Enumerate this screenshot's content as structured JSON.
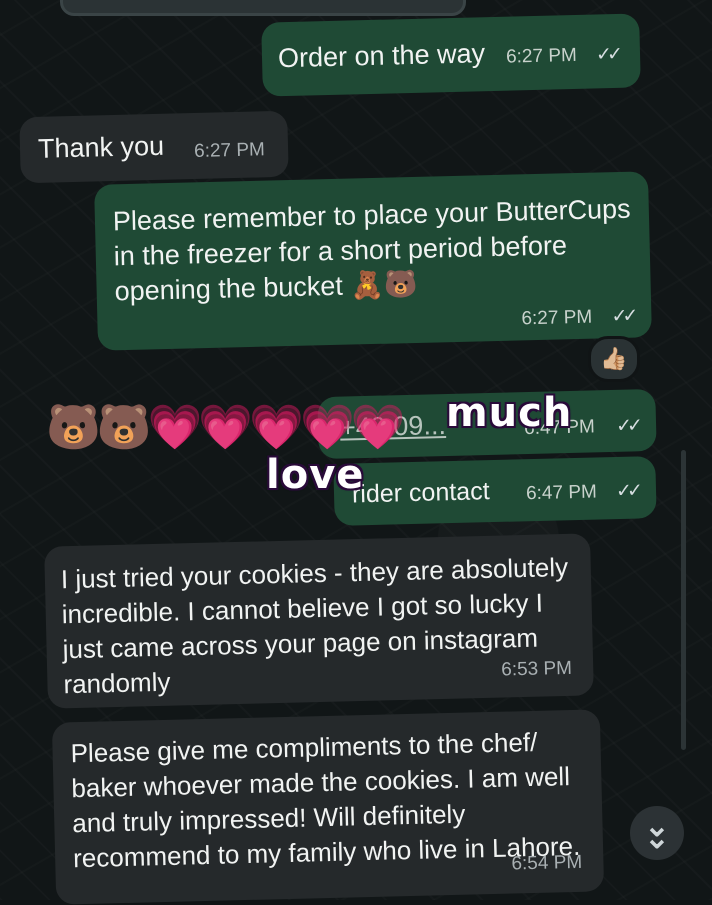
{
  "chat": {
    "messages": [
      {
        "direction": "outgoing",
        "text": "Order on the way",
        "time": "6:27 PM",
        "ticks": "✓✓"
      },
      {
        "direction": "incoming",
        "text": "Thank you",
        "time": "6:27 PM"
      },
      {
        "direction": "outgoing",
        "text": "Please remember to place your ButterCups in the freezer for a short period before opening the bucket 🧸🐻",
        "time": "6:27 PM",
        "ticks": "✓✓",
        "reaction": "👍🏼"
      },
      {
        "direction": "outgoing",
        "text": "+49 09...",
        "time": "6:47 PM",
        "ticks": "✓✓"
      },
      {
        "direction": "outgoing",
        "text": "rider contact",
        "time": "6:47 PM",
        "ticks": "✓✓"
      },
      {
        "direction": "incoming",
        "text": "I just tried your cookies - they are absolutely incredible. I cannot believe I got so lucky I just came across your page on instagram randomly",
        "time": "6:53 PM"
      },
      {
        "direction": "incoming",
        "text": "Please give me compliments to the chef/ baker whoever made the cookies. I am well and truly impressed! Will definitely recommend to my family who live in Lahore.",
        "time": "6:54 PM"
      }
    ]
  },
  "overlay": {
    "emojis": [
      "🐻",
      "🐻",
      "💗",
      "💗",
      "💗",
      "💗",
      "💗"
    ],
    "word_much": "much",
    "word_love": "love"
  },
  "controls": {
    "scroll_down_icon": "chevron-double-down-icon",
    "scroll_down_glyph": "⌄"
  },
  "colors": {
    "outgoing_bubble": "#1f4a35",
    "incoming_bubble": "#25292b",
    "background": "#111617"
  }
}
